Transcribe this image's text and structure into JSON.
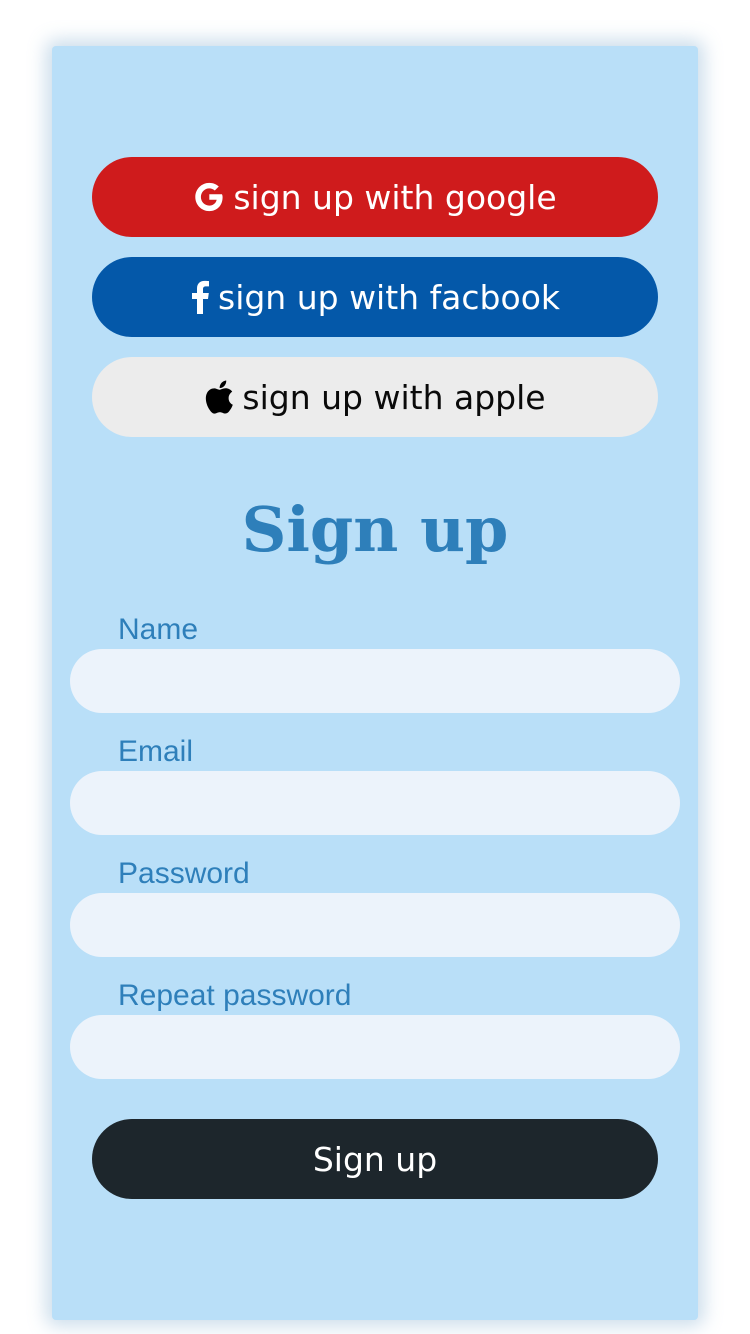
{
  "social": {
    "google": {
      "label": "sign up with google",
      "icon": "google-g-icon",
      "bg": "#cf1b1c",
      "fg": "#ffffff"
    },
    "facebook": {
      "label": "sign up with facbook",
      "icon": "facebook-f-icon",
      "bg": "#0458a9",
      "fg": "#ffffff"
    },
    "apple": {
      "label": "sign up with apple",
      "icon": "apple-icon",
      "bg": "#ececec",
      "fg": "#0a0a0a"
    }
  },
  "form": {
    "title": "Sign up",
    "fields": {
      "name": {
        "label": "Name",
        "value": "",
        "placeholder": ""
      },
      "email": {
        "label": "Email",
        "value": "",
        "placeholder": ""
      },
      "password": {
        "label": "Password",
        "value": "",
        "placeholder": ""
      },
      "repeat_password": {
        "label": "Repeat password",
        "value": "",
        "placeholder": ""
      }
    },
    "submit_label": "Sign up"
  },
  "colors": {
    "card_bg": "#b9dff8",
    "accent": "#2e7fba",
    "input_bg": "#ecf3fb",
    "submit_bg": "#1d262c"
  }
}
